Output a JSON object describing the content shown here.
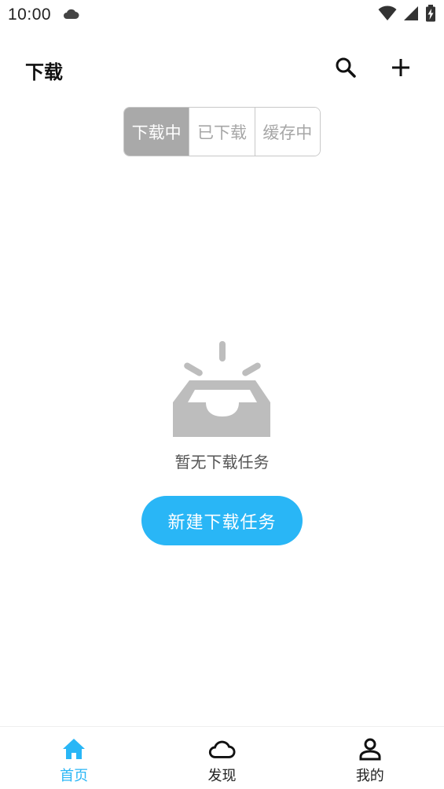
{
  "status_bar": {
    "time": "10:00",
    "icons": [
      "cloud-icon",
      "wifi-icon",
      "signal-icon",
      "battery-charging-icon"
    ]
  },
  "header": {
    "title": "下载",
    "actions": [
      "search-icon",
      "plus-icon"
    ]
  },
  "tabs": [
    {
      "label": "下载中",
      "active": true
    },
    {
      "label": "已下载",
      "active": false
    },
    {
      "label": "缓存中",
      "active": false
    }
  ],
  "empty_state": {
    "icon": "empty-inbox-icon",
    "message": "暂无下载任务",
    "button_label": "新建下载任务"
  },
  "bottom_nav": {
    "items": [
      {
        "label": "首页",
        "icon": "home-icon",
        "active": true
      },
      {
        "label": "发现",
        "icon": "cloud-icon",
        "active": false
      },
      {
        "label": "我的",
        "icon": "person-icon",
        "active": false
      }
    ]
  },
  "colors": {
    "accent": "#29b6f6",
    "segment_active_bg": "#a9a9a9",
    "segment_inactive_text": "#a6a6a6",
    "empty_icon": "#bdbdbd"
  }
}
